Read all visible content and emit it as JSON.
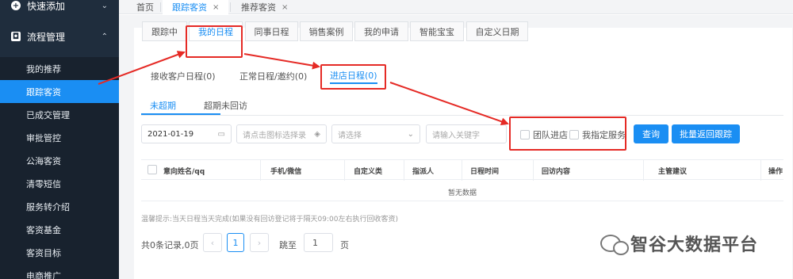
{
  "sidebar": {
    "group1": {
      "label": "快速添加",
      "icon": "plus-circle-icon",
      "chevron": "⌄"
    },
    "group2": {
      "label": "流程管理",
      "icon": "camera-icon",
      "chevron": "⌃"
    },
    "items": [
      {
        "label": "我的推荐"
      },
      {
        "label": "跟踪客资"
      },
      {
        "label": "已成交管理"
      },
      {
        "label": "审批管控"
      },
      {
        "label": "公海客资"
      },
      {
        "label": "清零短信"
      },
      {
        "label": "服务转介绍"
      },
      {
        "label": "客资基金"
      },
      {
        "label": "客资目标"
      },
      {
        "label": "电商推广"
      }
    ]
  },
  "top_tabs": [
    {
      "label": "首页"
    },
    {
      "label": "跟踪客资",
      "close": "×"
    },
    {
      "label": "推荐客资",
      "close": "×"
    }
  ],
  "level1_tabs": [
    "跟踪中",
    "我的日程",
    "同事日程",
    "销售案例",
    "我的申请",
    "智能宝宝",
    "自定义日期"
  ],
  "level2_tabs": [
    "接收客户日程(0)",
    "正常日程/邀约(0)",
    "进店日程(0)"
  ],
  "level3_tabs": [
    "未超期",
    "超期未回访"
  ],
  "filters": {
    "date_value": "2021-01-19",
    "location_placeholder": "请点击图标选择录",
    "select_placeholder": "请选择",
    "keyword_placeholder": "请输入关键字",
    "team_checkbox": "团队进店",
    "assigned_checkbox": "我指定服务",
    "query_button": "查询",
    "batch_button": "批量返回跟踪"
  },
  "table": {
    "headers": [
      "意向姓名/qq",
      "手机/微信",
      "自定义类",
      "指派人",
      "日程时间",
      "回访内容",
      "主管建议",
      "操作"
    ],
    "empty_text": "暂无数据"
  },
  "tip": "温馨提示:当天日程当天完成(如果没有回访登记将于隔天09:00左右执行回收客资)",
  "pagination": {
    "summary": "共0条记录,0页",
    "prev": "‹",
    "current_page": "1",
    "next": "›",
    "jump_label": "跳至",
    "jump_value": "1",
    "page_label": "页"
  },
  "watermark": "智谷大数据平台",
  "colors": {
    "accent": "#1a8ef3",
    "sidebar_bg": "#1f2d3d",
    "annotation": "#e52a25"
  }
}
